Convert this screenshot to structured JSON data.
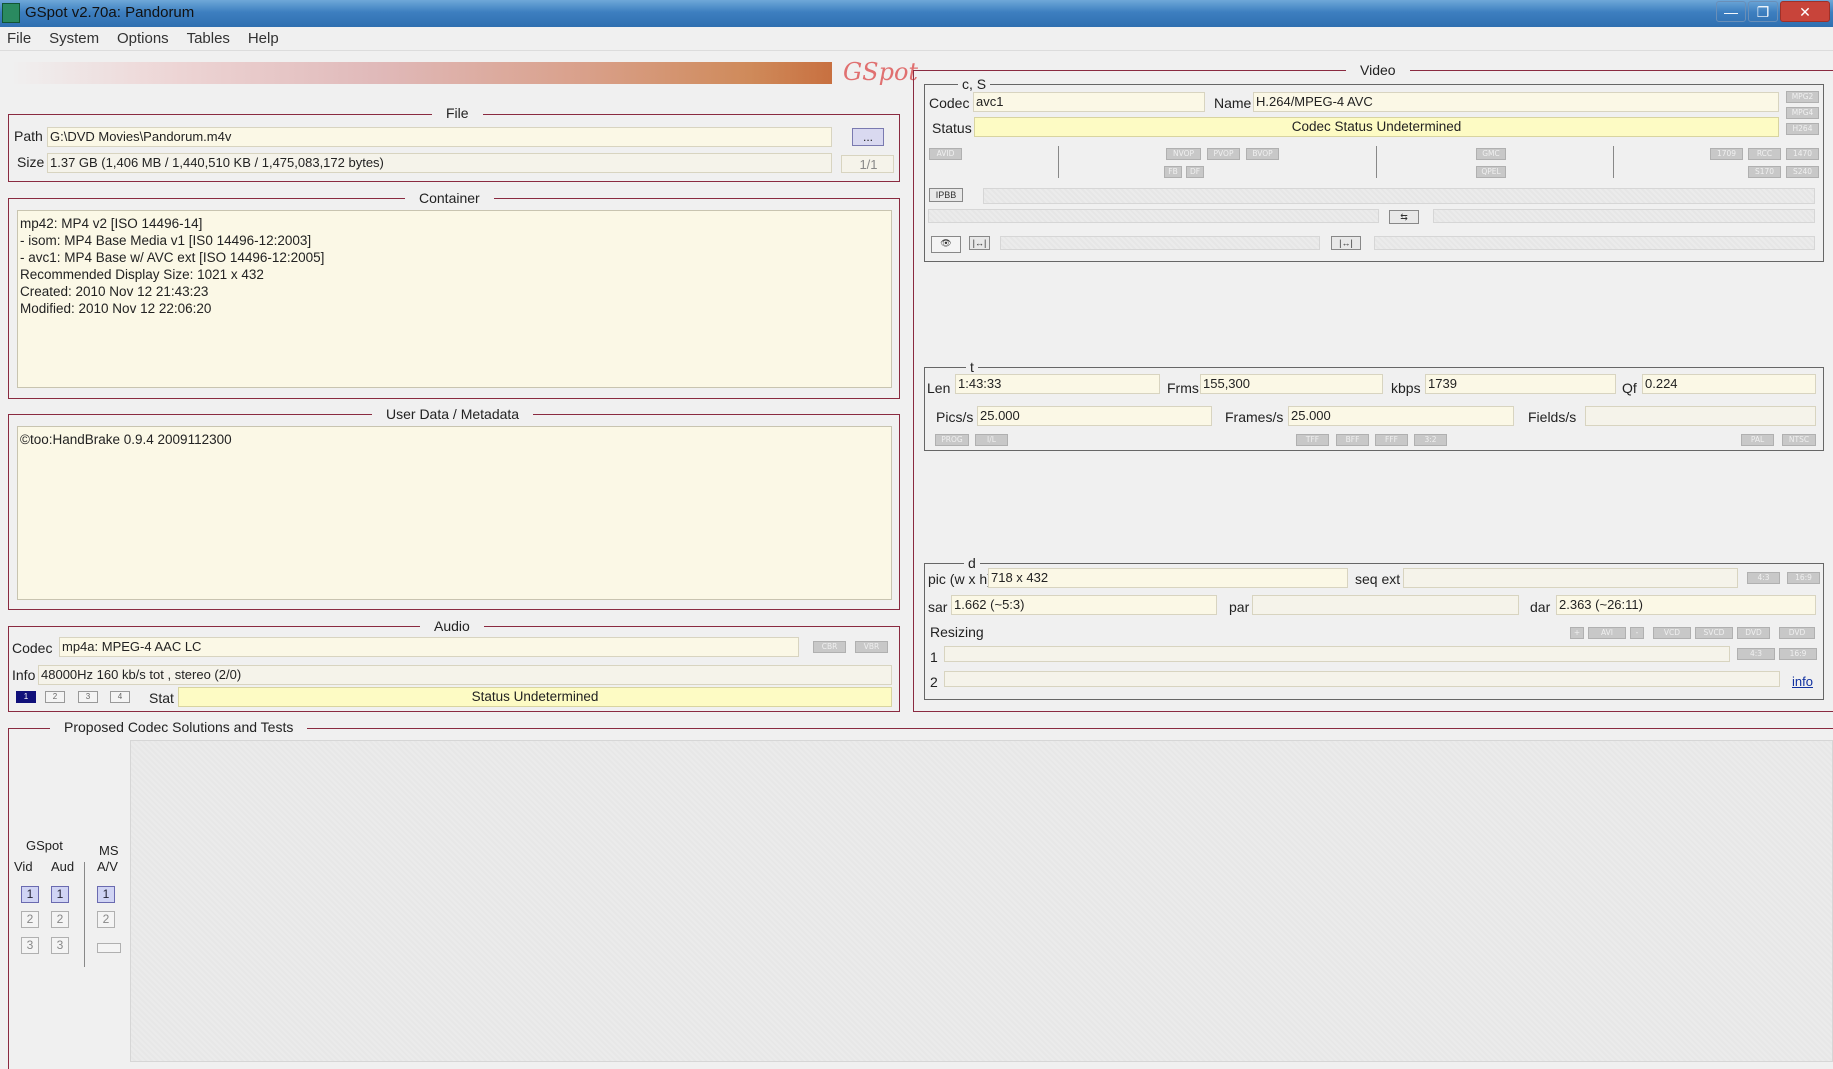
{
  "window": {
    "title": "GSpot v2.70a: Pandorum",
    "minimize": "—",
    "maximize": "❐",
    "close": "✕"
  },
  "menu": [
    "File",
    "System",
    "Options",
    "Tables",
    "Help"
  ],
  "logo": "GSpot",
  "file": {
    "title": "File",
    "path_label": "Path",
    "path": "G:\\DVD Movies\\Pandorum.m4v",
    "browse_label": "...",
    "size_label": "Size",
    "size": "1.37 GB (1,406 MB / 1,440,510 KB / 1,475,083,172 bytes)",
    "page": "1/1"
  },
  "container": {
    "title": "Container",
    "lines": [
      "mp42: MP4 v2 [ISO 14496-14]",
      "- isom: MP4  Base Media v1 [IS0 14496-12:2003]",
      "- avc1: MP4 Base w/ AVC ext [ISO 14496-12:2005]",
      "Recommended Display Size: 1021 x 432",
      "Created:  2010 Nov 12   21:43:23",
      "Modified: 2010 Nov 12   22:06:20"
    ]
  },
  "userdata": {
    "title": "User Data / Metadata",
    "lines": [
      "©too:HandBrake 0.9.4 2009112300"
    ]
  },
  "audio": {
    "title": "Audio",
    "codec_label": "Codec",
    "codec": "mp4a: MPEG-4 AAC LC",
    "cbr": "CBR",
    "vbr": "VBR",
    "info_label": "Info",
    "info": "48000Hz  160 kb/s tot , stereo (2/0)",
    "tabs": [
      "1",
      "2",
      "3",
      "4"
    ],
    "stat_label": "Stat",
    "stat": "Status Undetermined"
  },
  "video": {
    "title": "Video",
    "cs_title": "c, S",
    "codec_label": "Codec",
    "codec": "avc1",
    "name_label": "Name",
    "name": "H.264/MPEG-4 AVC",
    "status_label": "Status",
    "status": "Codec Status Undetermined",
    "side_pills": [
      "MPG2",
      "MPG4",
      "H264"
    ],
    "row1_pills": [
      "AVID",
      "NVOP",
      "PVOP",
      "BVOP",
      "GMC",
      "1709",
      "RCC",
      "1470"
    ],
    "row2_pills": [
      "FB",
      "DF",
      "QPEL",
      "S170",
      "S240"
    ],
    "t_title": "t",
    "len_label": "Len",
    "len": "1:43:33",
    "frms_label": "Frms",
    "frms": "155,300",
    "kbps_label": "kbps",
    "kbps": "1739",
    "qf_label": "Qf",
    "qf": "0.224",
    "pics_label": "Pics/s",
    "pics": "25.000",
    "frames_label": "Frames/s",
    "frames": "25.000",
    "fields_label": "Fields/s",
    "fields": "",
    "t_pills": [
      "PROG",
      "I/L",
      "TFF",
      "BFF",
      "FFF",
      "3:2",
      "PAL",
      "NTSC"
    ],
    "d_title": "d",
    "pic_label": "pic (w x h)",
    "pic": "718 x 432",
    "seqext_label": "seq ext",
    "seqext": "",
    "ar_pills": [
      "4:3",
      "16:9"
    ],
    "sar_label": "sar",
    "sar": "1.662 (~5:3)",
    "par_label": "par",
    "par": "",
    "dar_label": "dar",
    "dar": "2.363 (~26:11)",
    "resizing_label": "Resizing",
    "resize_pills": [
      "+",
      "AVI",
      "-",
      "VCD",
      "SVCD",
      "DVD",
      "DVD"
    ],
    "row1_label": "1",
    "row2_label": "2",
    "row1_pills2": [
      "4:3",
      "16:9"
    ],
    "info_link": "info"
  },
  "proposed": {
    "title": "Proposed Codec Solutions and Tests",
    "gspot_label": "GSpot",
    "vid_label": "Vid",
    "aud_label": "Aud",
    "ms_label": "MS",
    "av_label": "A/V",
    "vid_buttons": [
      "1",
      "2",
      "3"
    ],
    "aud_buttons": [
      "1",
      "2",
      "3"
    ],
    "ms_buttons": [
      "1",
      "2"
    ]
  }
}
